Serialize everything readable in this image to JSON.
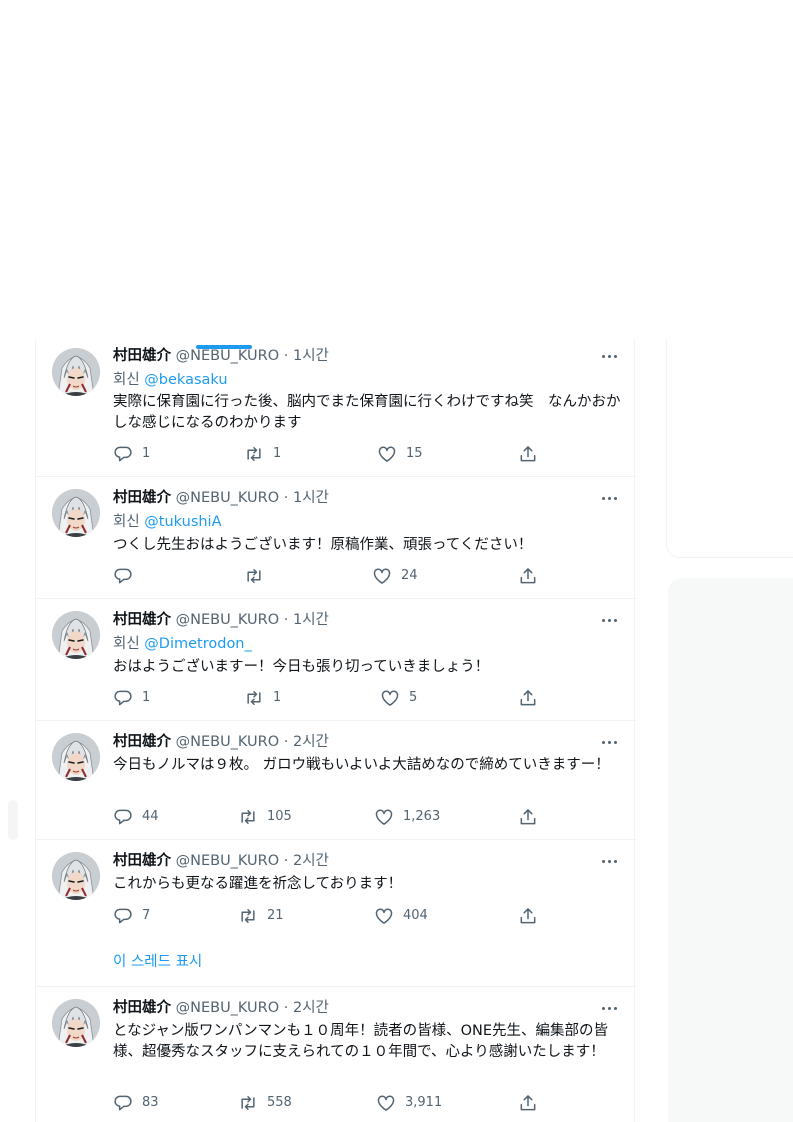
{
  "tabs": {
    "active_indicator_color": "#1d9bf0"
  },
  "colors": {
    "accent": "#1d9bf0",
    "secondary_text": "#536471",
    "border": "#eff3f4"
  },
  "icons": {
    "reply": "reply-icon",
    "retweet": "retweet-icon",
    "like": "like-icon",
    "share": "share-icon",
    "more": "more-icon"
  },
  "tweets": [
    {
      "name": "村田雄介",
      "handle": "@NEBU_KURO",
      "dot": "·",
      "time": "1시간",
      "reply_label": "회신",
      "reply_to": "@bekasaku",
      "text": "実際に保育園に行った後、脳内でまた保育園に行くわけですね笑　なんかおかしな感じになるのわかります",
      "replies": "1",
      "retweets": "1",
      "likes": "15"
    },
    {
      "name": "村田雄介",
      "handle": "@NEBU_KURO",
      "dot": "·",
      "time": "1시간",
      "reply_label": "회신",
      "reply_to": "@tukushiA",
      "text": "つくし先生おはようございます！原稿作業、頑張ってください！",
      "replies": "",
      "retweets": "",
      "likes": "24"
    },
    {
      "name": "村田雄介",
      "handle": "@NEBU_KURO",
      "dot": "·",
      "time": "1시간",
      "reply_label": "회신",
      "reply_to": "@Dimetrodon_",
      "text": "おはようございますー！今日も張り切っていきましょう！",
      "replies": "1",
      "retweets": "1",
      "likes": "5"
    },
    {
      "name": "村田雄介",
      "handle": "@NEBU_KURO",
      "dot": "·",
      "time": "2시간",
      "text": "今日もノルマは９枚。 ガロウ戦もいよいよ大詰めなので締めていきますー！",
      "replies": "44",
      "retweets": "105",
      "likes": "1,263"
    },
    {
      "name": "村田雄介",
      "handle": "@NEBU_KURO",
      "dot": "·",
      "time": "2시간",
      "text": "これからも更なる躍進を祈念しております！",
      "replies": "7",
      "retweets": "21",
      "likes": "404",
      "show_thread": "이 스레드 표시"
    },
    {
      "name": "村田雄介",
      "handle": "@NEBU_KURO",
      "dot": "·",
      "time": "2시간",
      "text": "となジャン版ワンパンマンも１０周年！読者の皆様、ONE先生、編集部の皆様、超優秀なスタッフに支えられての１０年間で、心より感謝いたします！",
      "replies": "83",
      "retweets": "558",
      "likes": "3,911"
    }
  ]
}
